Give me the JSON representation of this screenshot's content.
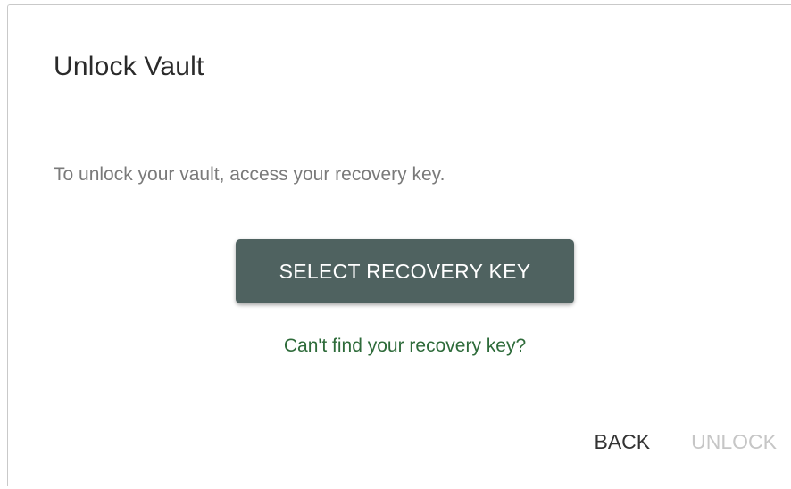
{
  "dialog": {
    "title": "Unlock Vault",
    "message": "To unlock your vault, access your recovery key.",
    "select_button_label": "SELECT RECOVERY KEY",
    "help_link": "Can't find your recovery key?",
    "back_label": "BACK",
    "unlock_label": "UNLOCK",
    "unlock_enabled": false
  },
  "colors": {
    "primary_button": "#4f6260",
    "link": "#2e6b3a",
    "disabled": "#c6c6c6"
  }
}
